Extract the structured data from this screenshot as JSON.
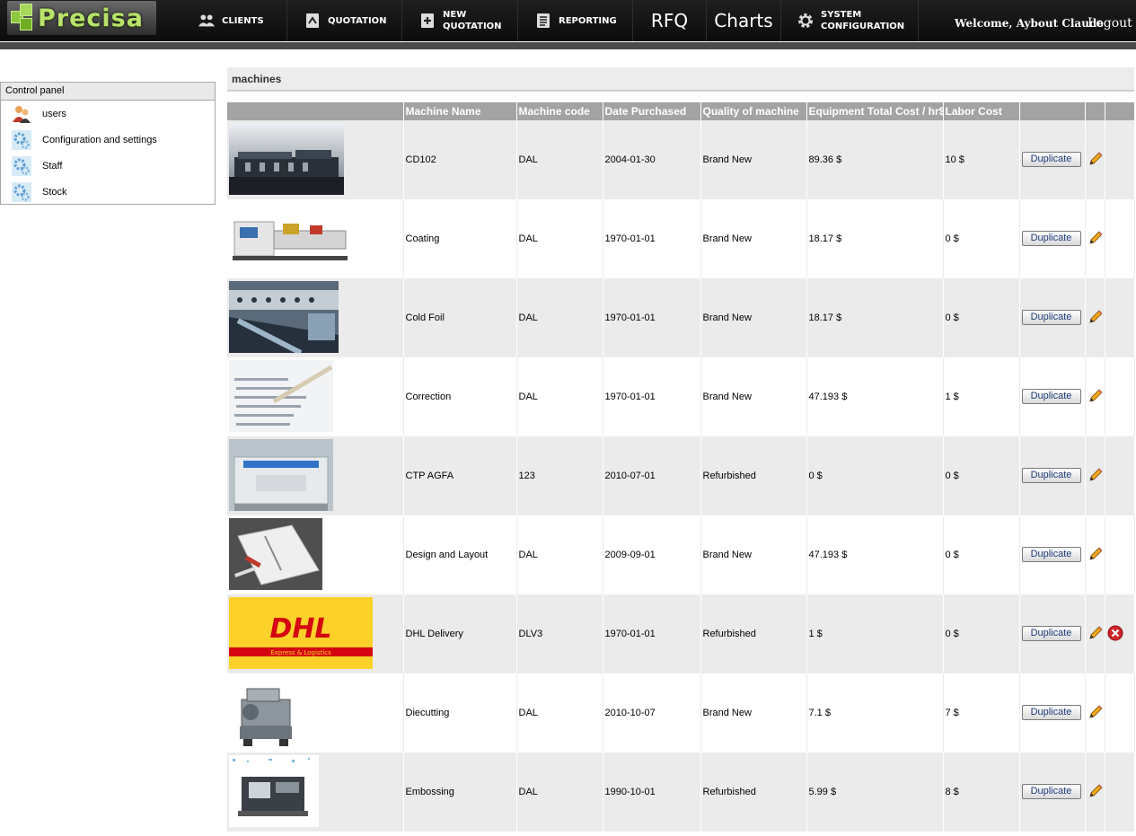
{
  "logo": {
    "text": "Precisa"
  },
  "nav": {
    "clients": "CLIENTS",
    "quotation": "QUOTATION",
    "new_quotation_1": "NEW",
    "new_quotation_2": "QUOTATION",
    "reporting": "REPORTING",
    "rfq": "RFQ",
    "charts": "Charts",
    "system_config_1": "SYSTEM",
    "system_config_2": "CONFIGURATION"
  },
  "user": {
    "welcome": "Welcome, Aybout Claude",
    "logout": "Logout"
  },
  "control_panel": {
    "title": "Control panel",
    "items": [
      {
        "label": "users",
        "icon": "users-icon"
      },
      {
        "label": "Configuration and settings",
        "icon": "settings-gear-icon"
      },
      {
        "label": "Staff",
        "icon": "settings-gear-icon"
      },
      {
        "label": "Stock",
        "icon": "settings-gear-icon"
      }
    ]
  },
  "main": {
    "title": "machines"
  },
  "table": {
    "headers": [
      "",
      "Machine Name",
      "Machine code",
      "Date Purchased",
      "Quality of machine",
      "Equipment Total Cost / hr$",
      "Labor Cost",
      "",
      "",
      ""
    ],
    "duplicate_label": "Duplicate",
    "rows": [
      {
        "name": "CD102",
        "code": "DAL",
        "date": "2004-01-30",
        "quality": "Brand New",
        "equip_cost": "89.36 $",
        "labor_cost": "10 $",
        "deletable": false
      },
      {
        "name": "Coating",
        "code": "DAL",
        "date": "1970-01-01",
        "quality": "Brand New",
        "equip_cost": "18.17 $",
        "labor_cost": "0 $",
        "deletable": false
      },
      {
        "name": "Cold Foil",
        "code": "DAL",
        "date": "1970-01-01",
        "quality": "Brand New",
        "equip_cost": "18.17 $",
        "labor_cost": "0 $",
        "deletable": false
      },
      {
        "name": "Correction",
        "code": "DAL",
        "date": "1970-01-01",
        "quality": "Brand New",
        "equip_cost": "47.193 $",
        "labor_cost": "1 $",
        "deletable": false
      },
      {
        "name": "CTP AGFA",
        "code": "123",
        "date": "2010-07-01",
        "quality": "Refurbished",
        "equip_cost": "0 $",
        "labor_cost": "0 $",
        "deletable": false
      },
      {
        "name": "Design and Layout",
        "code": "DAL",
        "date": "2009-09-01",
        "quality": "Brand New",
        "equip_cost": "47.193 $",
        "labor_cost": "0 $",
        "deletable": false
      },
      {
        "name": "DHL Delivery",
        "code": "DLV3",
        "date": "1970-01-01",
        "quality": "Refurbished",
        "equip_cost": "1 $",
        "labor_cost": "0 $",
        "deletable": true
      },
      {
        "name": "Diecutting",
        "code": "DAL",
        "date": "2010-10-07",
        "quality": "Brand New",
        "equip_cost": "7.1 $",
        "labor_cost": "7 $",
        "deletable": false
      },
      {
        "name": "Embossing",
        "code": "DAL",
        "date": "1990-10-01",
        "quality": "Refurbished",
        "equip_cost": "5.99 $",
        "labor_cost": "8 $",
        "deletable": false
      }
    ]
  },
  "dhl_logo": {
    "brand": "DHL",
    "tagline": "Express & Logistics"
  },
  "colors": {
    "nav_bg": "#111111",
    "header_row": "#a3a3a3",
    "row_alt": "#ebebeb",
    "logo_green": "#b8e26b",
    "delete_red": "#d0242a",
    "dhl_yellow": "#fcd12a",
    "dhl_red": "#d40511"
  }
}
